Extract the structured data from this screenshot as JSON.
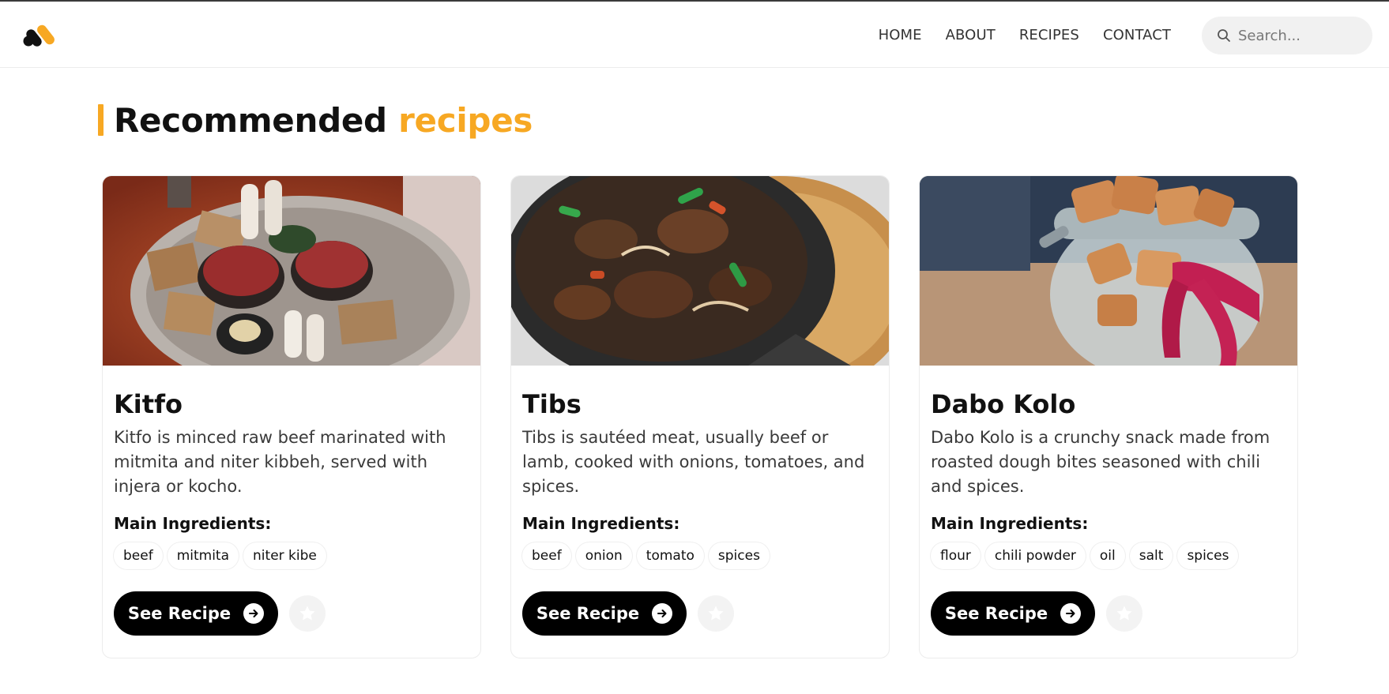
{
  "nav": {
    "items": [
      {
        "label": "HOME"
      },
      {
        "label": "ABOUT"
      },
      {
        "label": "RECIPES"
      },
      {
        "label": "CONTACT"
      }
    ],
    "search_placeholder": "Search..."
  },
  "section": {
    "title_main": "Recommended",
    "title_accent": "recipes"
  },
  "cards": [
    {
      "title": "Kitfo",
      "description": "Kitfo is minced raw beef marinated with mitmita and niter kibbeh, served with injera or kocho.",
      "ingredients_label": "Main Ingredients:",
      "ingredients": [
        "beef",
        "mitmita",
        "niter kibe"
      ],
      "button_label": "See Recipe"
    },
    {
      "title": "Tibs",
      "description": "Tibs is sautéed meat, usually beef or lamb, cooked with onions, tomatoes, and spices.",
      "ingredients_label": "Main Ingredients:",
      "ingredients": [
        "beef",
        "onion",
        "tomato",
        "spices"
      ],
      "button_label": "See Recipe"
    },
    {
      "title": "Dabo Kolo",
      "description": "Dabo Kolo is a crunchy snack made from roasted dough bites seasoned with chili and spices.",
      "ingredients_label": "Main Ingredients:",
      "ingredients": [
        "flour",
        "chili powder",
        "oil",
        "salt",
        "spices"
      ],
      "button_label": "See Recipe"
    }
  ],
  "colors": {
    "accent": "#f7a823",
    "button": "#000000",
    "nav_text": "#333333"
  },
  "icons": {
    "search": "search-icon",
    "arrow": "arrow-right-circle-icon",
    "favorite": "star-icon"
  }
}
